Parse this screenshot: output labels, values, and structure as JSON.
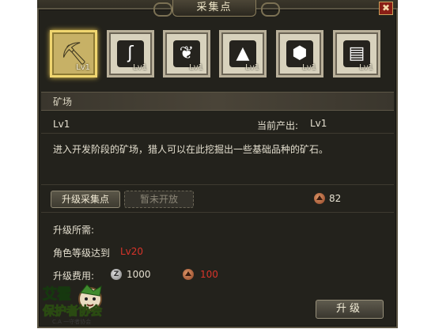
{
  "window": {
    "title": "采集点",
    "close_glyph": "✖"
  },
  "tools": [
    {
      "icon": "pickaxe-icon",
      "glyph": "⛏",
      "level": "Lv1",
      "active": true
    },
    {
      "icon": "fishing-rod-icon",
      "glyph": "ʃ",
      "level": "Lv1",
      "active": false
    },
    {
      "icon": "herb-icon",
      "glyph": "❦",
      "level": "Lv1",
      "active": false
    },
    {
      "icon": "stone-pile-icon",
      "glyph": "▲",
      "level": "Lv1",
      "active": false
    },
    {
      "icon": "hex-ore-icon",
      "glyph": "⬢",
      "level": "Lv1",
      "active": false
    },
    {
      "icon": "scroll-icon",
      "glyph": "▤",
      "level": "Lv1",
      "active": false
    }
  ],
  "section": {
    "title": "矿场"
  },
  "info": {
    "level": "Lv1",
    "output_label": "当前产出:",
    "output_value": "Lv1",
    "description": "进入开发阶段的矿场，猎人可以在此挖掘出一些基础品种的矿石。"
  },
  "tabs": {
    "upgrade": "升级采集点",
    "locked": "暂未开放"
  },
  "ore_count": "82",
  "requirements": {
    "header": "升级所需:",
    "role_level_label": "角色等级达到",
    "role_level_value": "Lv20",
    "cost_label": "升级费用:",
    "silver_cost": "1000",
    "ore_cost": "100"
  },
  "upgrade_button": "升级",
  "watermark": {
    "line1": "艾霍",
    "line2": "保护者协会",
    "line3": "C.A 一守者协会"
  },
  "colors": {
    "accent_gold": "#f0d670",
    "cost_red": "#d8342a"
  }
}
